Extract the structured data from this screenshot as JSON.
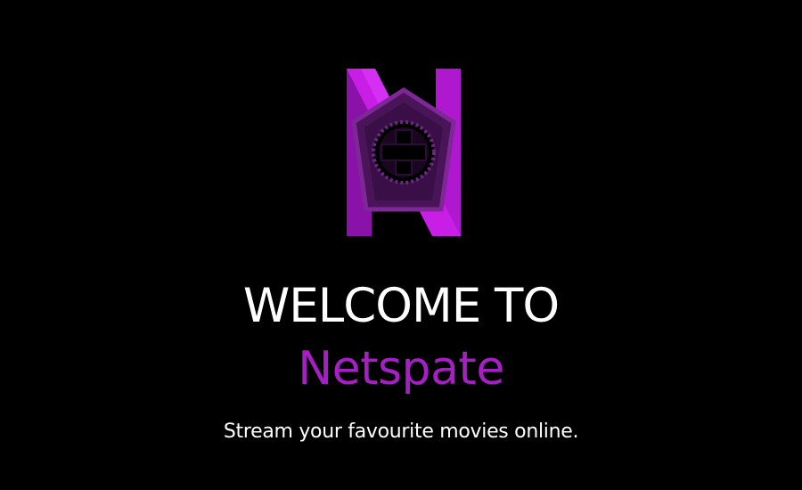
{
  "hero": {
    "logo_icon": "netspate-n-pentagon-logo",
    "welcome_text": "WELCOME TO",
    "brand_name": "Netspate",
    "tagline": "Stream your favourite movies online."
  },
  "colors": {
    "background": "#000000",
    "text": "#ffffff",
    "brand": "#a51fc4",
    "logo_light": "#c81ee6",
    "logo_dark": "#5a1a6e"
  }
}
